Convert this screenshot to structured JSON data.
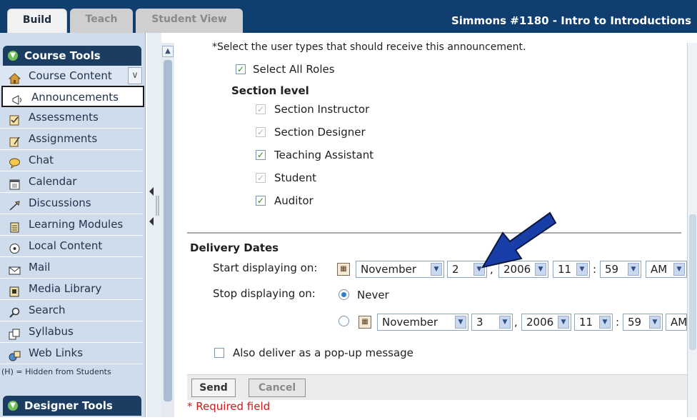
{
  "tabs": {
    "build": "Build",
    "teach": "Teach",
    "student_view": "Student View"
  },
  "course_title": "Simmons #1180 - Intro to Introductions",
  "sidebar": {
    "course_tools_header": "Course Tools",
    "designer_tools_header": "Designer Tools",
    "items": [
      {
        "label": "Course Content",
        "icon": "house-icon"
      },
      {
        "label": "Announcements",
        "icon": "megaphone-icon"
      },
      {
        "label": "Assessments",
        "icon": "assessment-icon"
      },
      {
        "label": "Assignments",
        "icon": "assignment-icon"
      },
      {
        "label": "Chat",
        "icon": "chat-icon"
      },
      {
        "label": "Calendar",
        "icon": "calendar-icon"
      },
      {
        "label": "Discussions",
        "icon": "discussion-icon"
      },
      {
        "label": "Learning Modules",
        "icon": "module-icon"
      },
      {
        "label": "Local Content",
        "icon": "local-content-icon"
      },
      {
        "label": "Mail",
        "icon": "mail-icon"
      },
      {
        "label": "Media Library",
        "icon": "media-library-icon"
      },
      {
        "label": "Search",
        "icon": "search-icon"
      },
      {
        "label": "Syllabus",
        "icon": "syllabus-icon"
      },
      {
        "label": "Web Links",
        "icon": "web-links-icon"
      }
    ],
    "hidden_note": "(H) = Hidden from Students"
  },
  "form": {
    "user_types_prompt": "*Select the user types that should receive this announcement.",
    "select_all_roles": "Select All Roles",
    "section_level": "Section level",
    "roles": [
      {
        "label": "Section Instructor",
        "checked": true,
        "disabled": true
      },
      {
        "label": "Section Designer",
        "checked": true,
        "disabled": true
      },
      {
        "label": "Teaching Assistant",
        "checked": true,
        "disabled": false
      },
      {
        "label": "Student",
        "checked": true,
        "disabled": true
      },
      {
        "label": "Auditor",
        "checked": true,
        "disabled": false
      }
    ],
    "delivery_dates": "Delivery Dates",
    "start_label": "Start displaying on:",
    "stop_label": "Stop displaying on:",
    "never_label": "Never",
    "start": {
      "month": "November",
      "day": "2",
      "year": "2006",
      "hour": "11",
      "minute": "59",
      "ampm": "AM"
    },
    "stop": {
      "month": "November",
      "day": "3",
      "year": "2006",
      "hour": "11",
      "minute": "59",
      "ampm": "AM"
    },
    "comma": ",",
    "colon": ":",
    "popup_label": "Also deliver as a pop-up message"
  },
  "buttons": {
    "send": "Send",
    "cancel": "Cancel"
  },
  "required_note": "* Required field",
  "colors": {
    "topbar": "#0f3e6f",
    "sidebar": "#cfdcec",
    "arrow": "#1a3ea8",
    "required": "#cc1b1b"
  }
}
